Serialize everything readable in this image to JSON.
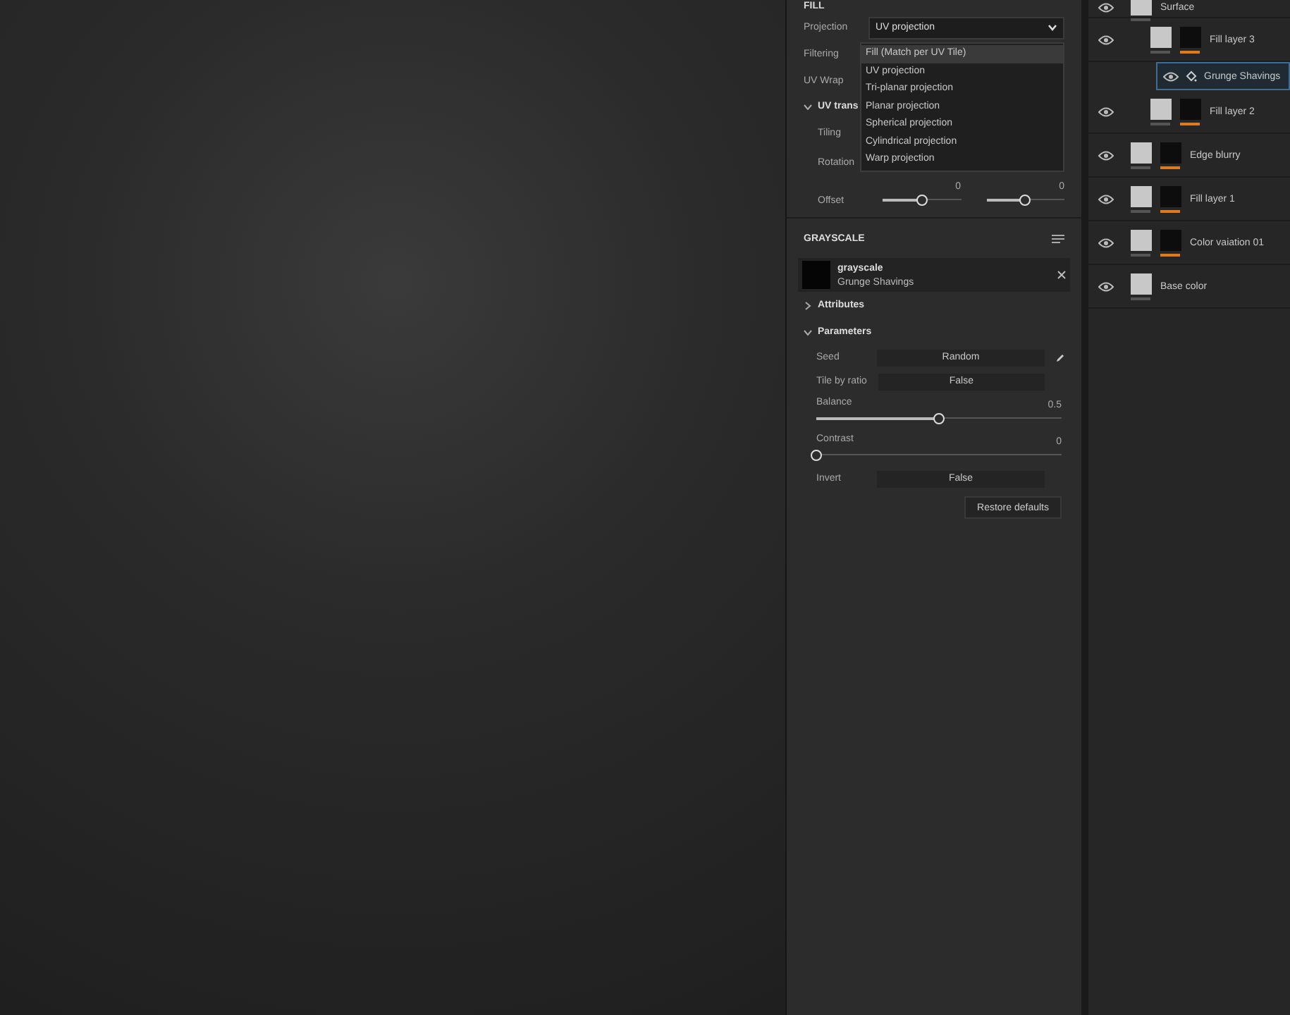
{
  "properties": {
    "section_title": "FILL",
    "projection": {
      "label": "Projection",
      "value": "UV projection",
      "expanded": true,
      "options": [
        {
          "label": "Fill (Match per UV Tile)",
          "highlighted": true
        },
        {
          "label": "UV projection",
          "highlighted": false
        },
        {
          "label": "Tri-planar projection",
          "highlighted": false
        },
        {
          "label": "Planar projection",
          "highlighted": false
        },
        {
          "label": "Spherical projection",
          "highlighted": false
        },
        {
          "label": "Cylindrical projection",
          "highlighted": false
        },
        {
          "label": "Warp projection",
          "highlighted": false
        }
      ]
    },
    "filtering_label": "Filtering",
    "uv_wrap_label": "UV Wrap",
    "uv_transform_label": "UV trans",
    "tiling_label": "Tiling",
    "rotation_label": "Rotation",
    "offset": {
      "label": "Offset",
      "sliders": [
        {
          "reading": "0",
          "level": 0.5
        },
        {
          "reading": "0",
          "level": 0.5
        }
      ]
    },
    "grayscale": {
      "title": "GRAYSCALE",
      "resource": {
        "name": "grayscale",
        "subtitle": "Grunge Shavings"
      },
      "attributes": {
        "label": "Attributes",
        "expanded": false
      },
      "parameters": {
        "label": "Parameters",
        "expanded": true,
        "rows": [
          {
            "kind": "field",
            "label": "Seed",
            "value": "Random",
            "editable": true
          },
          {
            "kind": "field",
            "label": "Tile by ratio",
            "value": "False",
            "editable": false
          },
          {
            "kind": "slider",
            "label": "Balance",
            "reading": "0.5",
            "level": 0.5
          },
          {
            "kind": "slider",
            "label": "Contrast",
            "reading": "0",
            "level": 0
          },
          {
            "kind": "field",
            "label": "Invert",
            "value": "False",
            "editable": false
          }
        ]
      },
      "restore_button": "Restore defaults"
    }
  },
  "layers": [
    {
      "name": "Surface",
      "visible": true,
      "masked": false,
      "selected": false,
      "children": [
        {
          "name": "Fill layer 3",
          "visible": true,
          "masked": true,
          "selected": false,
          "children": [
            {
              "name": "Grunge Shavings",
              "visible": true,
              "selected": true,
              "kind": "effect"
            }
          ]
        },
        {
          "name": "Fill layer 2",
          "visible": true,
          "masked": true,
          "selected": false
        }
      ]
    },
    {
      "name": "Edge blurry",
      "visible": true,
      "masked": true,
      "selected": false
    },
    {
      "name": "Fill layer 1",
      "visible": true,
      "masked": true,
      "selected": false
    },
    {
      "name": "Color vaiation 01",
      "visible": true,
      "masked": true,
      "selected": false
    },
    {
      "name": "Base color",
      "visible": true,
      "masked": false,
      "selected": false
    }
  ]
}
